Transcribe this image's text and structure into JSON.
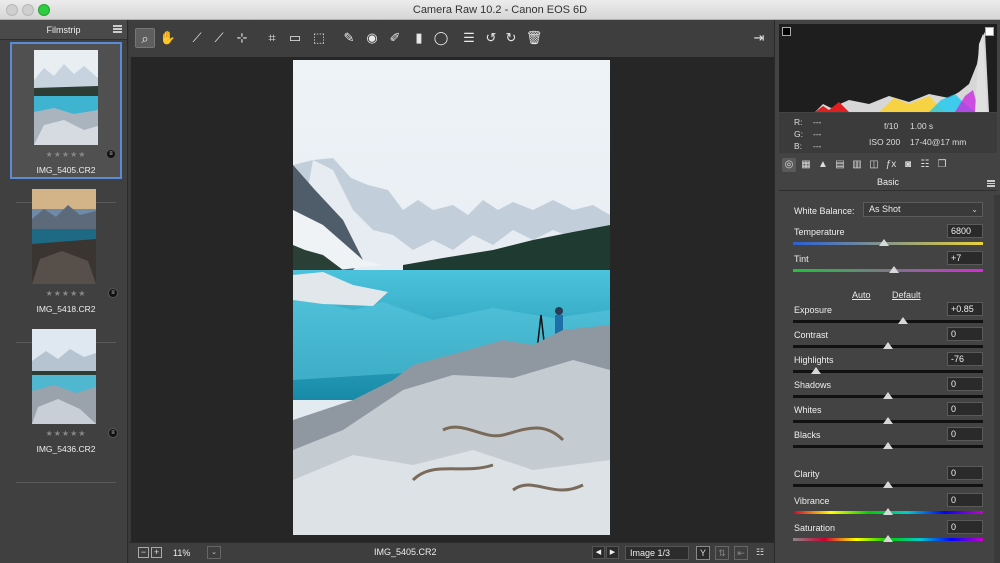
{
  "window": {
    "title": "Camera Raw 10.2  -  Canon EOS 6D"
  },
  "filmstrip": {
    "title": "Filmstrip",
    "items": [
      {
        "name": "IMG_5405.CR2",
        "stars": "★★★★★",
        "selected": true
      },
      {
        "name": "IMG_5418.CR2",
        "stars": "★★★★★",
        "selected": false
      },
      {
        "name": "IMG_5436.CR2",
        "stars": "★★★★★",
        "selected": false
      }
    ]
  },
  "toolbar": {
    "tools": [
      "zoom-tool",
      "hand-tool",
      "white-balance-tool",
      "color-sampler-tool",
      "targeted-adjustment-tool",
      "crop-tool",
      "straighten-tool",
      "transform-tool",
      "spot-removal-tool",
      "red-eye-tool",
      "adjustment-brush",
      "graduated-filter",
      "radial-filter",
      "preferences",
      "rotate-ccw",
      "rotate-cw",
      "trash"
    ]
  },
  "bottombar": {
    "zoom": "11%",
    "filename": "IMG_5405.CR2",
    "image_count": "Image 1/3"
  },
  "readout": {
    "r_label": "R:",
    "g_label": "G:",
    "b_label": "B:",
    "r": "---",
    "g": "---",
    "b": "---",
    "aperture": "f/10",
    "shutter": "1.00 s",
    "iso": "ISO 200",
    "lens": "17-40@17 mm"
  },
  "panel": {
    "title": "Basic",
    "white_balance_label": "White Balance:",
    "white_balance_value": "As Shot",
    "auto": "Auto",
    "default": "Default",
    "sliders": [
      {
        "label": "Temperature",
        "value": "6800",
        "position": 0.48
      },
      {
        "label": "Tint",
        "value": "+7",
        "position": 0.53
      },
      {
        "label": "Exposure",
        "value": "+0.85",
        "position": 0.58
      },
      {
        "label": "Contrast",
        "value": "0",
        "position": 0.5
      },
      {
        "label": "Highlights",
        "value": "-76",
        "position": 0.12
      },
      {
        "label": "Shadows",
        "value": "0",
        "position": 0.5
      },
      {
        "label": "Whites",
        "value": "0",
        "position": 0.5
      },
      {
        "label": "Blacks",
        "value": "0",
        "position": 0.5
      },
      {
        "label": "Clarity",
        "value": "0",
        "position": 0.5
      },
      {
        "label": "Vibrance",
        "value": "0",
        "position": 0.5
      },
      {
        "label": "Saturation",
        "value": "0",
        "position": 0.5
      }
    ]
  },
  "colors": {
    "accent": "#5a8bd6",
    "panel": "#434343",
    "canvas": "#262626"
  }
}
